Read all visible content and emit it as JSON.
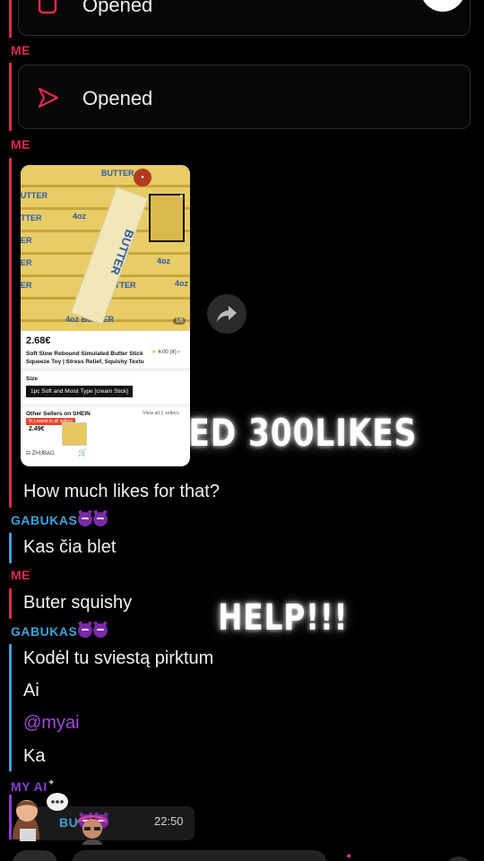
{
  "chat": {
    "opened_label_1": "Opened",
    "opened_label_2": "Opened",
    "sender_me": "ME",
    "sender_gabukas": "GABUKAS",
    "sender_ai": "MY AI",
    "msg_how_much": "How much likes for that?",
    "msg_kas_cia": "Kas čia blet",
    "msg_buter": "Buter squishy",
    "msg_kodel": "Kodėl tu sviestą pirktum",
    "msg_ai": "Ai",
    "msg_mention": "@myai",
    "msg_ka": "Ka",
    "footer_name": "BU",
    "footer_time": "22:50"
  },
  "snap": {
    "price": "2.68€",
    "rating": "4.00 (4)",
    "product_title": "Soft Slow Rebound Simulated Butter Stick Squeeze Toy | Stress Relief, Squishy Textu",
    "size_label": "Size",
    "size_option": "1pc Soft and Moist Type [cream Stick]",
    "other_sellers": "Other Sellers on SHEIN",
    "view_all": "View all 1 sellers",
    "lowest": "% Lowest in all sellers",
    "seller_price": "2.49€",
    "seller_name": "ZHUBAO",
    "butter_text": "BUTTER",
    "butter_small": "4oz",
    "pager": "1/6"
  },
  "overlay": {
    "need_text": "I NEED 300LIKES",
    "help_text": "HELP!!!"
  },
  "colors": {
    "me": "#e0294c",
    "gabukas": "#3aa3dc",
    "ai": "#8b3bd6"
  }
}
